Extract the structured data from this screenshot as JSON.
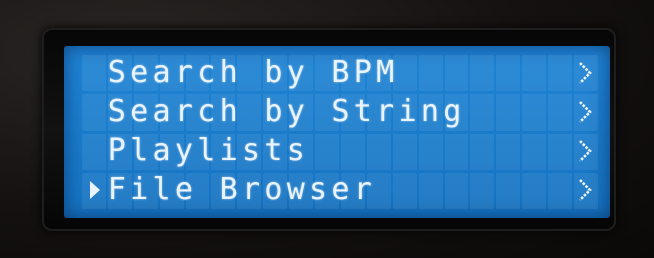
{
  "lcd_menu": {
    "items": [
      {
        "label": "Search by BPM",
        "selected": false,
        "arrow": ">"
      },
      {
        "label": "Search by String",
        "selected": false,
        "arrow": ">"
      },
      {
        "label": "Playlists",
        "selected": false,
        "arrow": ">"
      },
      {
        "label": "File Browser",
        "selected": true,
        "arrow": ">"
      }
    ],
    "colors": {
      "screen": "#1a7ccc",
      "text": "#eaf4ff",
      "bezel": "#0b0a09"
    },
    "icons": {
      "cursor": "triangle-right-icon",
      "submenu": "chevron-right-icon"
    }
  }
}
